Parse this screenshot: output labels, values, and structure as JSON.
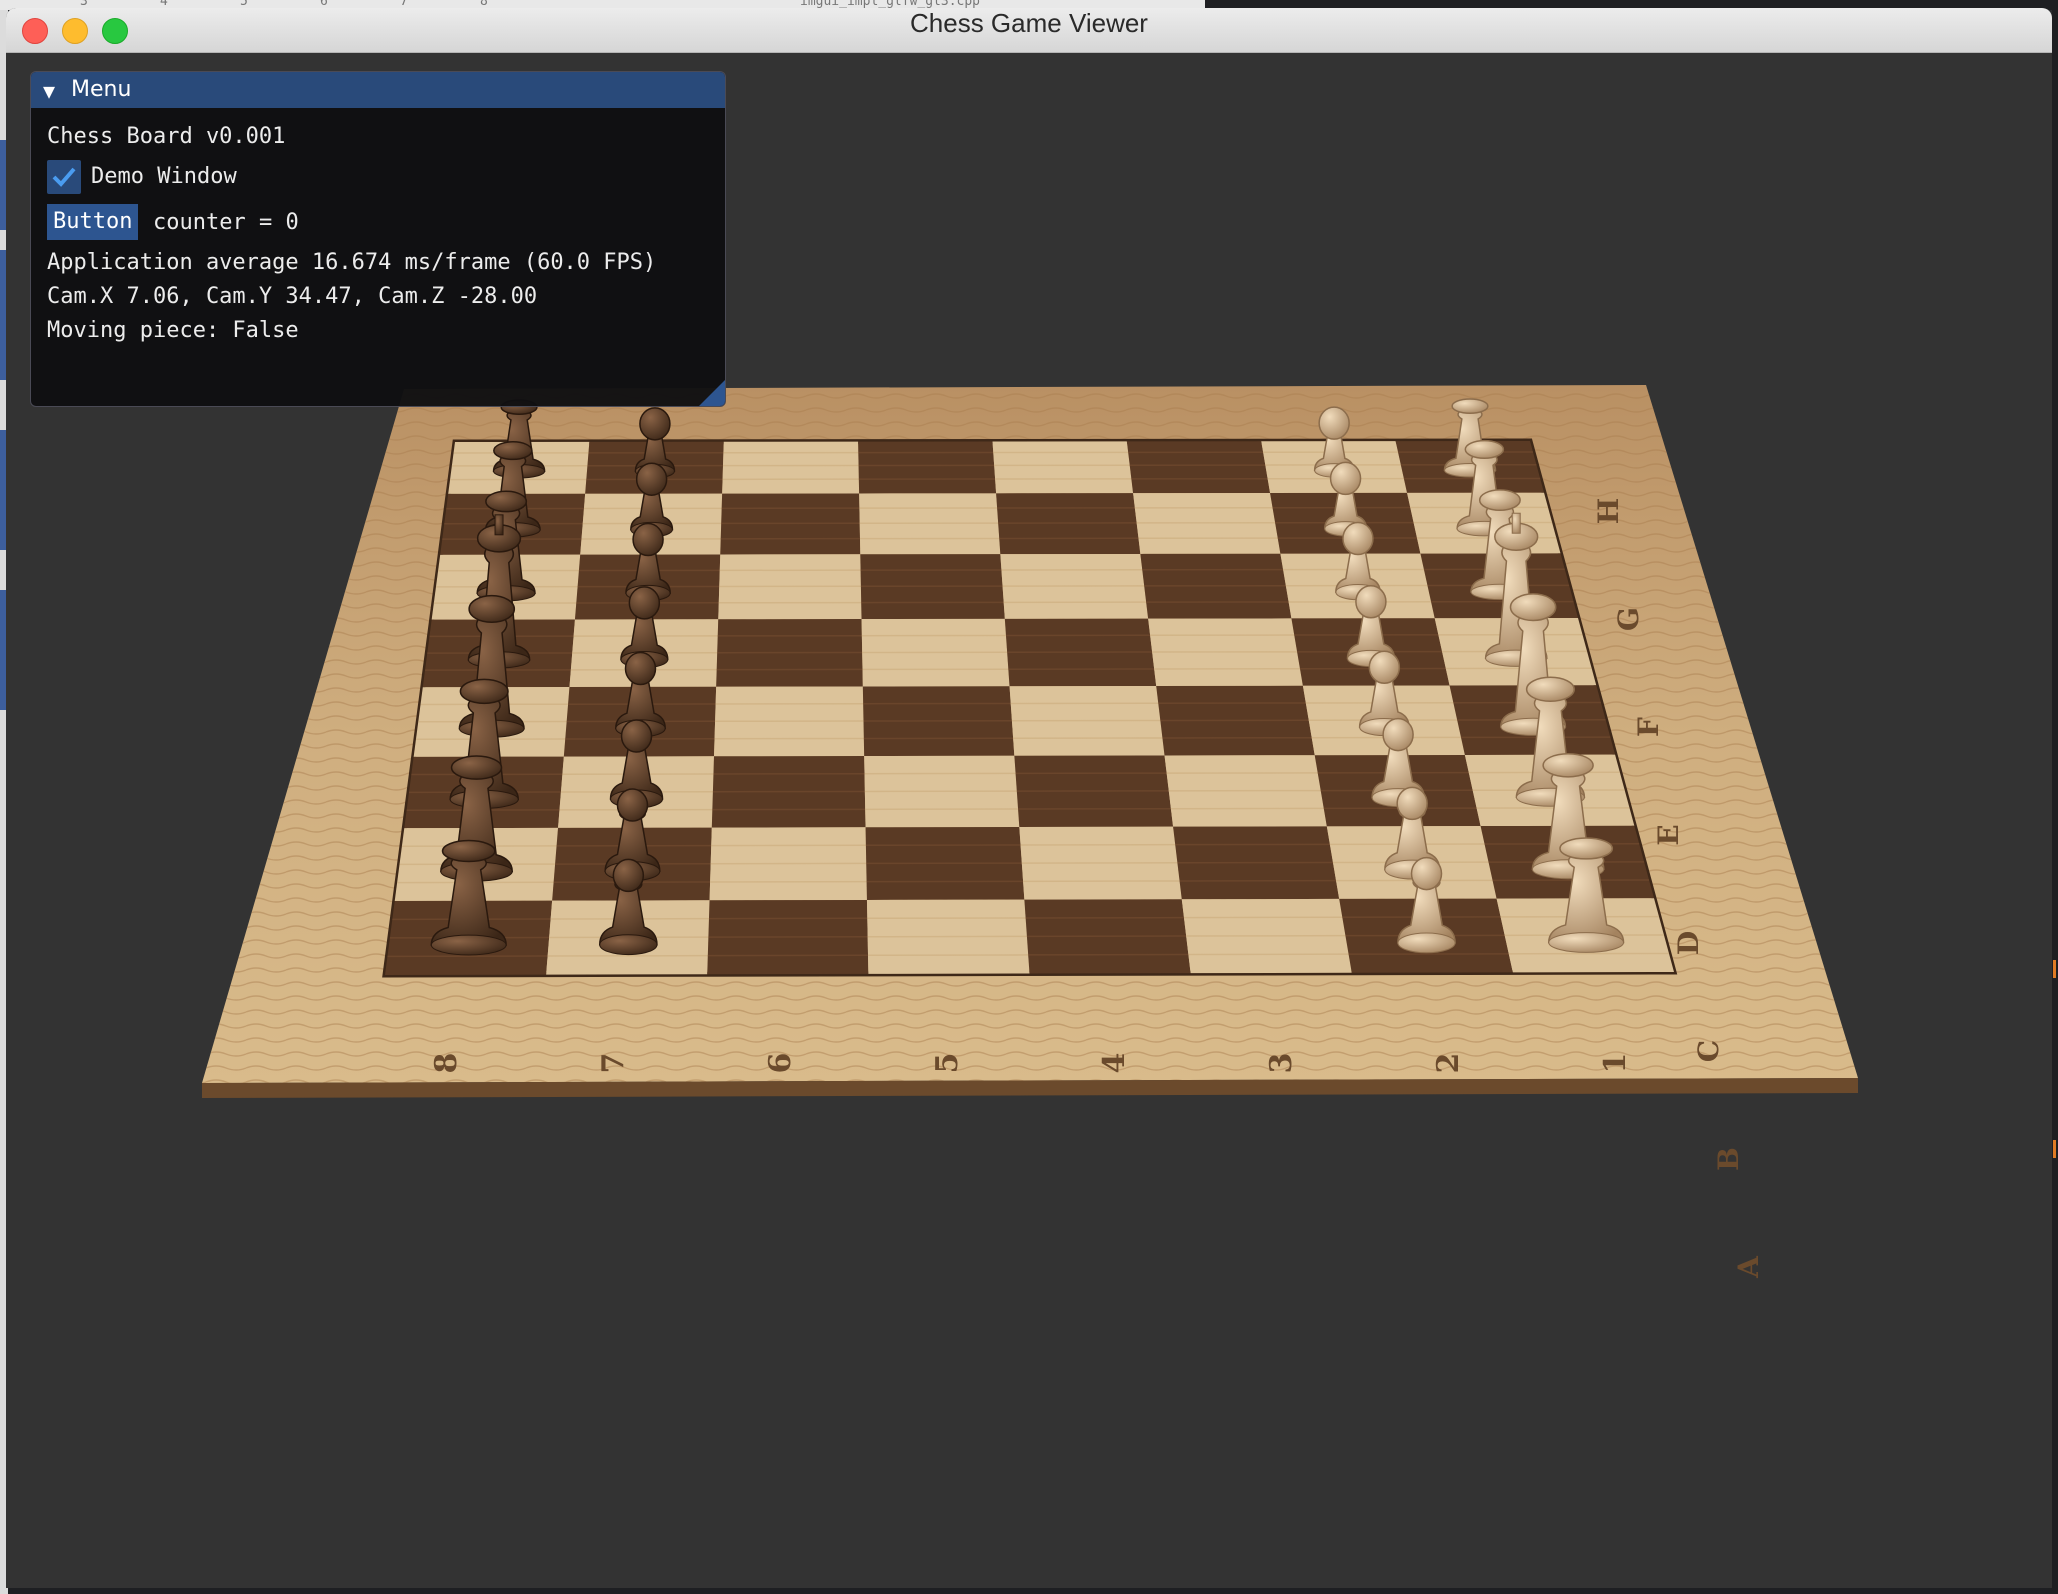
{
  "window": {
    "title": "Chess Game Viewer"
  },
  "menu_panel": {
    "header": "Menu",
    "version_text": "Chess Board v0.001",
    "demo_checkbox_label": "Demo Window",
    "demo_checkbox_checked": true,
    "button_label": "Button",
    "counter_text": "counter = 0",
    "fps_text": "Application average 16.674 ms/frame (60.0 FPS)",
    "camera_text": "Cam.X 7.06, Cam.Y 34.47, Cam.Z -28.00",
    "moving_piece_text": "Moving piece: False"
  },
  "board": {
    "rank_labels": [
      "8",
      "7",
      "6",
      "5",
      "4",
      "3",
      "2",
      "1"
    ],
    "file_labels": [
      "H",
      "G",
      "F",
      "E",
      "D",
      "C",
      "B",
      "A"
    ],
    "pieces": [
      {
        "side": "dark",
        "type": "rook",
        "square": "A8"
      },
      {
        "side": "dark",
        "type": "knight",
        "square": "B8"
      },
      {
        "side": "dark",
        "type": "bishop",
        "square": "C8"
      },
      {
        "side": "dark",
        "type": "queen",
        "square": "D8"
      },
      {
        "side": "dark",
        "type": "king",
        "square": "E8"
      },
      {
        "side": "dark",
        "type": "bishop",
        "square": "F8"
      },
      {
        "side": "dark",
        "type": "knight",
        "square": "G8"
      },
      {
        "side": "dark",
        "type": "rook",
        "square": "H8"
      },
      {
        "side": "dark",
        "type": "pawn",
        "square": "A7"
      },
      {
        "side": "dark",
        "type": "pawn",
        "square": "B7"
      },
      {
        "side": "dark",
        "type": "pawn",
        "square": "C7"
      },
      {
        "side": "dark",
        "type": "pawn",
        "square": "D7"
      },
      {
        "side": "dark",
        "type": "pawn",
        "square": "E7"
      },
      {
        "side": "dark",
        "type": "pawn",
        "square": "F7"
      },
      {
        "side": "dark",
        "type": "pawn",
        "square": "G7"
      },
      {
        "side": "dark",
        "type": "pawn",
        "square": "H7"
      },
      {
        "side": "light",
        "type": "rook",
        "square": "A1"
      },
      {
        "side": "light",
        "type": "knight",
        "square": "B1"
      },
      {
        "side": "light",
        "type": "bishop",
        "square": "C1"
      },
      {
        "side": "light",
        "type": "queen",
        "square": "D1"
      },
      {
        "side": "light",
        "type": "king",
        "square": "E1"
      },
      {
        "side": "light",
        "type": "bishop",
        "square": "F1"
      },
      {
        "side": "light",
        "type": "knight",
        "square": "G1"
      },
      {
        "side": "light",
        "type": "rook",
        "square": "H1"
      },
      {
        "side": "light",
        "type": "pawn",
        "square": "A2"
      },
      {
        "side": "light",
        "type": "pawn",
        "square": "B2"
      },
      {
        "side": "light",
        "type": "pawn",
        "square": "C2"
      },
      {
        "side": "light",
        "type": "pawn",
        "square": "D2"
      },
      {
        "side": "light",
        "type": "pawn",
        "square": "E2"
      },
      {
        "side": "light",
        "type": "pawn",
        "square": "F2"
      },
      {
        "side": "light",
        "type": "pawn",
        "square": "G2"
      },
      {
        "side": "light",
        "type": "pawn",
        "square": "H2"
      }
    ]
  },
  "colors": {
    "viewport_bg": "#333333",
    "board_frame": "#c9a978",
    "light_square": "#dcc39a",
    "dark_square": "#5a3a24",
    "dark_piece": "#4a3121",
    "light_piece": "#c6a883",
    "imgui_accent": "#294a7a"
  }
}
